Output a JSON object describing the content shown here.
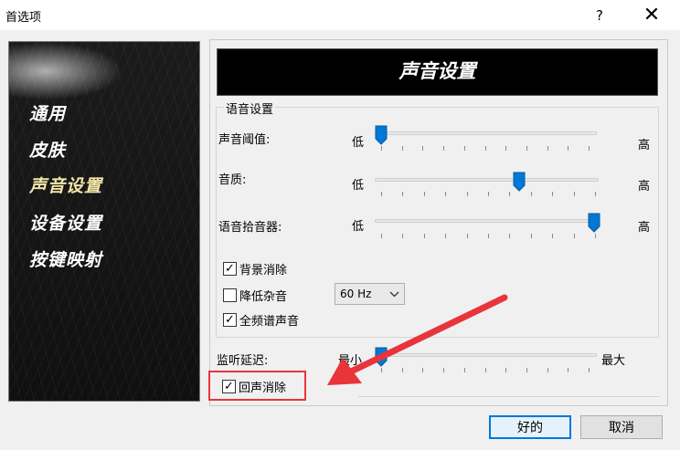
{
  "window": {
    "title": "首选项",
    "help": "?",
    "close": "✕"
  },
  "sidebar": {
    "items": [
      {
        "label": "通用",
        "active": false
      },
      {
        "label": "皮肤",
        "active": false
      },
      {
        "label": "声音设置",
        "active": true
      },
      {
        "label": "设备设置",
        "active": false
      },
      {
        "label": "按键映射",
        "active": false
      }
    ]
  },
  "main": {
    "banner_title": "声音设置",
    "group_label": "语音设置",
    "sliders": [
      {
        "label": "声音阈值:",
        "min_label": "低",
        "max_label": "高",
        "level": 0.0
      },
      {
        "label": "音质:",
        "min_label": "低",
        "max_label": "高",
        "level": 0.65
      },
      {
        "label": "语音拾音器:",
        "min_label": "低",
        "max_label": "高",
        "level": 1.0
      }
    ],
    "checkboxes": [
      {
        "label": "背景消除",
        "checked": true
      },
      {
        "label": "降低杂音",
        "checked": false
      },
      {
        "label": "全频谱声音",
        "checked": true
      }
    ],
    "noise_select": {
      "value": "60 Hz"
    },
    "latency": {
      "label": "监听延迟:",
      "min_label": "最小",
      "max_label": "最大",
      "level": 0.0
    },
    "echo": {
      "label": "回声消除",
      "checked": true
    }
  },
  "footer": {
    "ok": "好的",
    "cancel": "取消"
  },
  "colors": {
    "accent_blue": "#0078d7",
    "annotation_red": "#e8343a",
    "active_sidebar": "#f3e6a8"
  }
}
